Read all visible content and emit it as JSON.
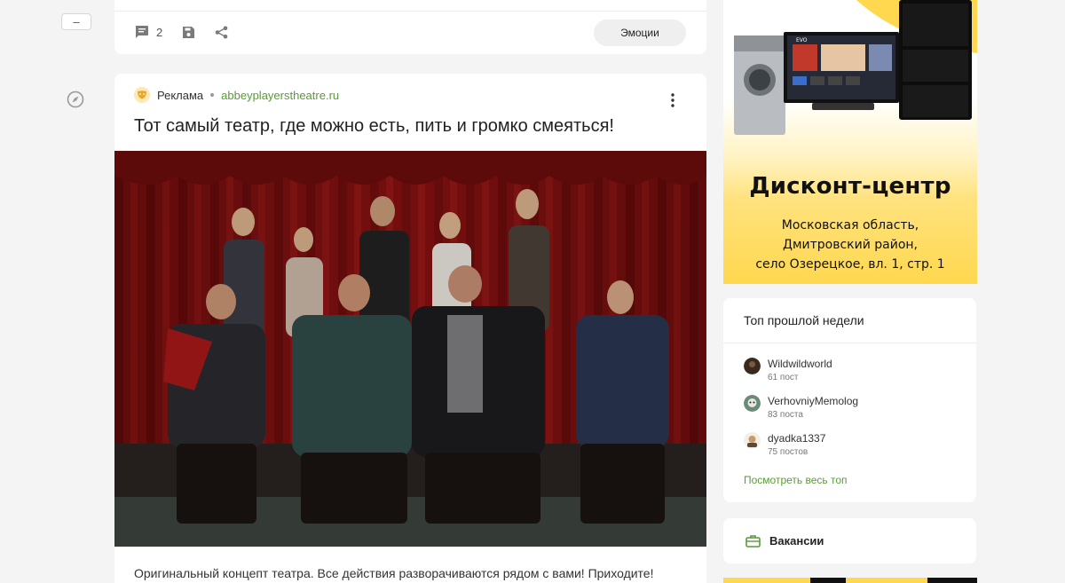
{
  "left_rail": {
    "collapse_label": "–"
  },
  "prev_post": {
    "comments_count": "2",
    "emotions_label": "Эмоции"
  },
  "ad_post": {
    "ad_label": "Реклама",
    "domain": "abbeyplayerstheatre.ru",
    "title": "Тот самый театр, где можно есть, пить и громко смеяться!",
    "description": "Оригинальный концепт театра. Все действия разворачиваются рядом с вами! Приходите!"
  },
  "banner": {
    "tv_brand": "EVO",
    "title": "Дисконт-центр",
    "lines": [
      "Московская область,",
      "Дмитровский район,",
      "село Озерецкое, вл. 1, стр. 1"
    ],
    "accent_color": "#ffd84f"
  },
  "top_week": {
    "heading": "Топ прошлой недели",
    "users": [
      {
        "name": "Wildwildworld",
        "posts": "61 пост"
      },
      {
        "name": "VerhovniyMemolog",
        "posts": "83 поста"
      },
      {
        "name": "dyadka1337",
        "posts": "75 постов"
      }
    ],
    "see_all": "Посмотреть весь топ"
  },
  "vacancies": {
    "label": "Вакансии"
  },
  "colors": {
    "link_green": "#5a9a3a",
    "page_bg": "#f4f4f4"
  }
}
